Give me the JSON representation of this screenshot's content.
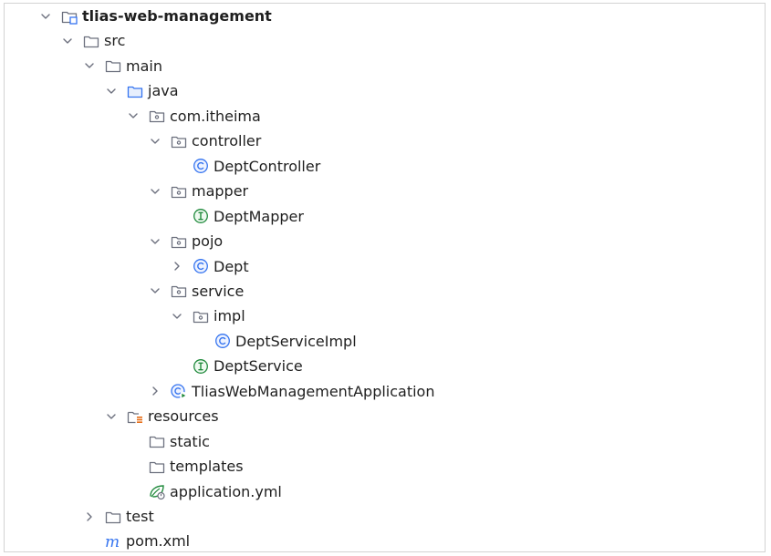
{
  "tree": {
    "items": [
      {
        "label": "tlias-web-management",
        "depth": 0,
        "expanded": true,
        "icon": "module-folder-icon",
        "bold": true
      },
      {
        "label": "src",
        "depth": 1,
        "expanded": true,
        "icon": "folder-icon"
      },
      {
        "label": "main",
        "depth": 2,
        "expanded": true,
        "icon": "folder-icon"
      },
      {
        "label": "java",
        "depth": 3,
        "expanded": true,
        "icon": "source-folder-icon"
      },
      {
        "label": "com.itheima",
        "depth": 4,
        "expanded": true,
        "icon": "package-icon"
      },
      {
        "label": "controller",
        "depth": 5,
        "expanded": true,
        "icon": "package-icon"
      },
      {
        "label": "DeptController",
        "depth": 6,
        "expanded": null,
        "icon": "class-icon"
      },
      {
        "label": "mapper",
        "depth": 5,
        "expanded": true,
        "icon": "package-icon"
      },
      {
        "label": "DeptMapper",
        "depth": 6,
        "expanded": null,
        "icon": "interface-icon"
      },
      {
        "label": "pojo",
        "depth": 5,
        "expanded": true,
        "icon": "package-icon"
      },
      {
        "label": "Dept",
        "depth": 6,
        "expanded": false,
        "icon": "class-icon"
      },
      {
        "label": "service",
        "depth": 5,
        "expanded": true,
        "icon": "package-icon"
      },
      {
        "label": "impl",
        "depth": 6,
        "expanded": true,
        "icon": "package-icon"
      },
      {
        "label": "DeptServiceImpl",
        "depth": 7,
        "expanded": null,
        "icon": "class-icon"
      },
      {
        "label": "DeptService",
        "depth": 6,
        "expanded": null,
        "icon": "interface-icon"
      },
      {
        "label": "TliasWebManagementApplication",
        "depth": 5,
        "expanded": false,
        "icon": "spring-boot-app-icon"
      },
      {
        "label": "resources",
        "depth": 3,
        "expanded": true,
        "icon": "resources-folder-icon"
      },
      {
        "label": "static",
        "depth": 4,
        "expanded": null,
        "icon": "folder-icon"
      },
      {
        "label": "templates",
        "depth": 4,
        "expanded": null,
        "icon": "folder-icon"
      },
      {
        "label": "application.yml",
        "depth": 4,
        "expanded": null,
        "icon": "spring-config-icon"
      },
      {
        "label": "test",
        "depth": 2,
        "expanded": false,
        "icon": "folder-icon"
      },
      {
        "label": "pom.xml",
        "depth": 2,
        "expanded": null,
        "icon": "maven-icon"
      }
    ]
  },
  "colors": {
    "folder": "#6c707e",
    "source_folder": "#3574f0",
    "class": "#3574f0",
    "interface": "#208a3c",
    "maven": "#3574f0",
    "resources_bars": "#e66d17",
    "spring": "#208a3c"
  }
}
